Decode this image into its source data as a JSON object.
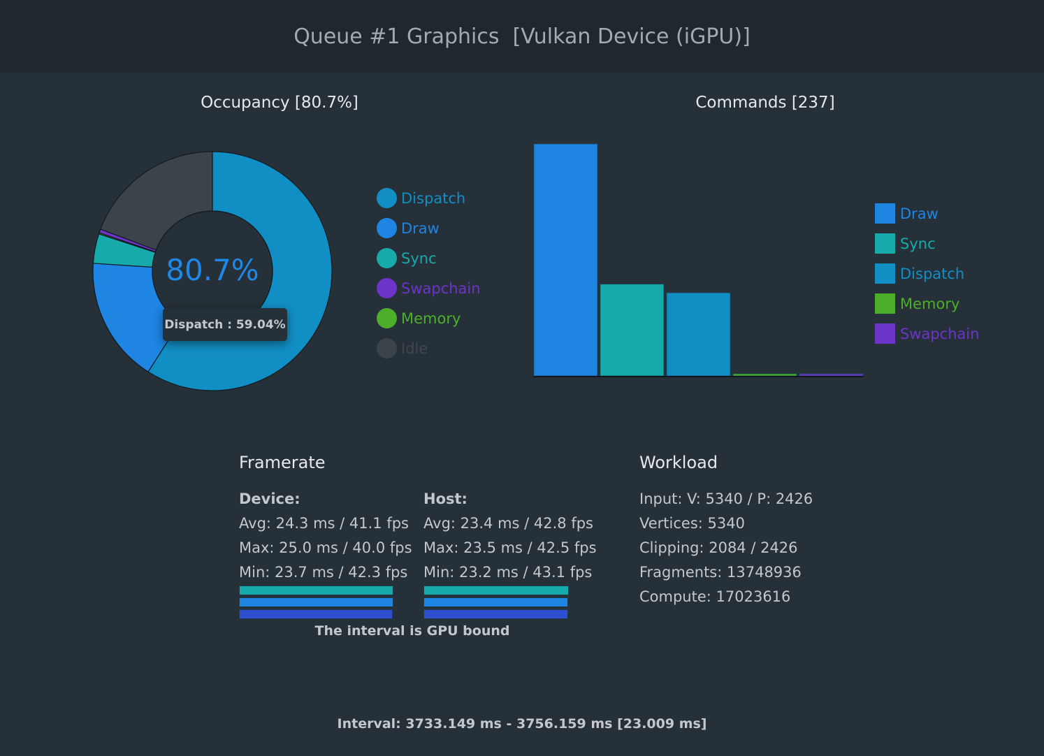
{
  "header": {
    "title": "Queue #1 Graphics  [Vulkan Device (iGPU)]"
  },
  "occupancy": {
    "title": "Occupancy [80.7%]",
    "center_label": "80.7%",
    "tooltip": "Dispatch : 59.04%",
    "legend": [
      {
        "label": "Dispatch",
        "color": "#118fc5",
        "icon": "circle"
      },
      {
        "label": "Draw",
        "color": "#1e85e2",
        "icon": "circle"
      },
      {
        "label": "Sync",
        "color": "#17aaaa",
        "icon": "circle"
      },
      {
        "label": "Swapchain",
        "color": "#6c34c8",
        "icon": "circle"
      },
      {
        "label": "Memory",
        "color": "#4caf2a",
        "icon": "circle"
      },
      {
        "label": "Idle",
        "color": "#3b434b",
        "icon": "circle"
      }
    ]
  },
  "commands": {
    "title": "Commands [237]",
    "legend": [
      {
        "label": "Draw",
        "color": "#1e85e2"
      },
      {
        "label": "Sync",
        "color": "#17aaaa"
      },
      {
        "label": "Dispatch",
        "color": "#118fc5"
      },
      {
        "label": "Memory",
        "color": "#4caf2a"
      },
      {
        "label": "Swapchain",
        "color": "#6c34c8"
      }
    ]
  },
  "chart_data": [
    {
      "type": "pie",
      "title": "Occupancy [80.7%]",
      "variant": "donut",
      "center_label": "80.7%",
      "labels": [
        "Dispatch",
        "Draw",
        "Sync",
        "Swapchain",
        "Memory",
        "Idle"
      ],
      "values": [
        59.04,
        17.0,
        4.0,
        0.5,
        0.16,
        19.3
      ],
      "colors": [
        "#118fc5",
        "#1e85e2",
        "#17aaaa",
        "#6c34c8",
        "#4caf2a",
        "#3b434b"
      ],
      "order_clockwise_from_top": [
        "Dispatch",
        "Draw",
        "Sync",
        "Memory",
        "Swapchain",
        "Idle"
      ],
      "legend_position": "right"
    },
    {
      "type": "bar",
      "title": "Commands [237]",
      "categories": [
        "Draw",
        "Sync",
        "Dispatch",
        "Memory",
        "Swapchain"
      ],
      "values": [
        134,
        53,
        48,
        1,
        1
      ],
      "colors": [
        "#1e85e2",
        "#17aaaa",
        "#118fc5",
        "#4caf2a",
        "#6c34c8"
      ],
      "xlabel": "",
      "ylabel": "",
      "ylim": [
        0,
        134
      ],
      "grid": false,
      "legend_position": "right"
    }
  ],
  "framerate": {
    "title": "Framerate",
    "device": {
      "heading": "Device:",
      "rows": [
        "Avg: 24.3 ms / 41.1 fps",
        "Max: 25.0 ms / 40.0 fps",
        "Min: 23.7 ms / 42.3 fps"
      ],
      "bars_ms": {
        "max": 25.0,
        "avg": 24.3,
        "min": 23.7
      }
    },
    "host": {
      "heading": "Host:",
      "rows": [
        "Avg: 23.4 ms / 42.8 fps",
        "Max: 23.5 ms / 42.5 fps",
        "Min: 23.2 ms / 43.1 fps"
      ],
      "bars_ms": {
        "max": 23.5,
        "avg": 23.4,
        "min": 23.2
      }
    },
    "bar_colors": [
      "#17aaaa",
      "#1e85e2",
      "#2d4fd0"
    ],
    "note": "The interval is GPU bound"
  },
  "workload": {
    "title": "Workload",
    "rows": [
      "Input: V: 5340 / P: 2426",
      "Vertices: 5340",
      "Clipping: 2084 / 2426",
      "Fragments: 13748936",
      "Compute: 17023616"
    ]
  },
  "footer": {
    "interval": "Interval: 3733.149 ms - 3756.159 ms [23.009 ms]"
  }
}
